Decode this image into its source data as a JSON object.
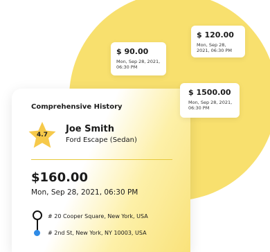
{
  "colors": {
    "accent_yellow": "#f8e06e",
    "star": "#f6c94a",
    "destination_dot": "#2f8be6"
  },
  "price_tags": [
    {
      "amount": "$ 90.00",
      "datetime": "Mon, Sep 28, 2021, 06:30 PM"
    },
    {
      "amount": "$ 120.00",
      "datetime": "Mon, Sep 28, 2021, 06:30 PM"
    },
    {
      "amount": "$ 1500.00",
      "datetime": "Mon, Sep 28, 2021, 06:30 PM"
    }
  ],
  "card": {
    "title": "Comprehensive History",
    "rating": "4.7",
    "driver_name": "Joe Smith",
    "vehicle": "Ford Escape (Sedan)",
    "total": "$160.00",
    "datetime": "Mon, Sep 28, 2021, 06:30 PM",
    "pickup": "# 20 Cooper Square, New York, USA",
    "dropoff": "# 2nd St, New York, NY 10003, USA",
    "icons": {
      "rating": "star-icon",
      "pickup": "pin-icon",
      "dropoff": "dot-icon"
    }
  }
}
